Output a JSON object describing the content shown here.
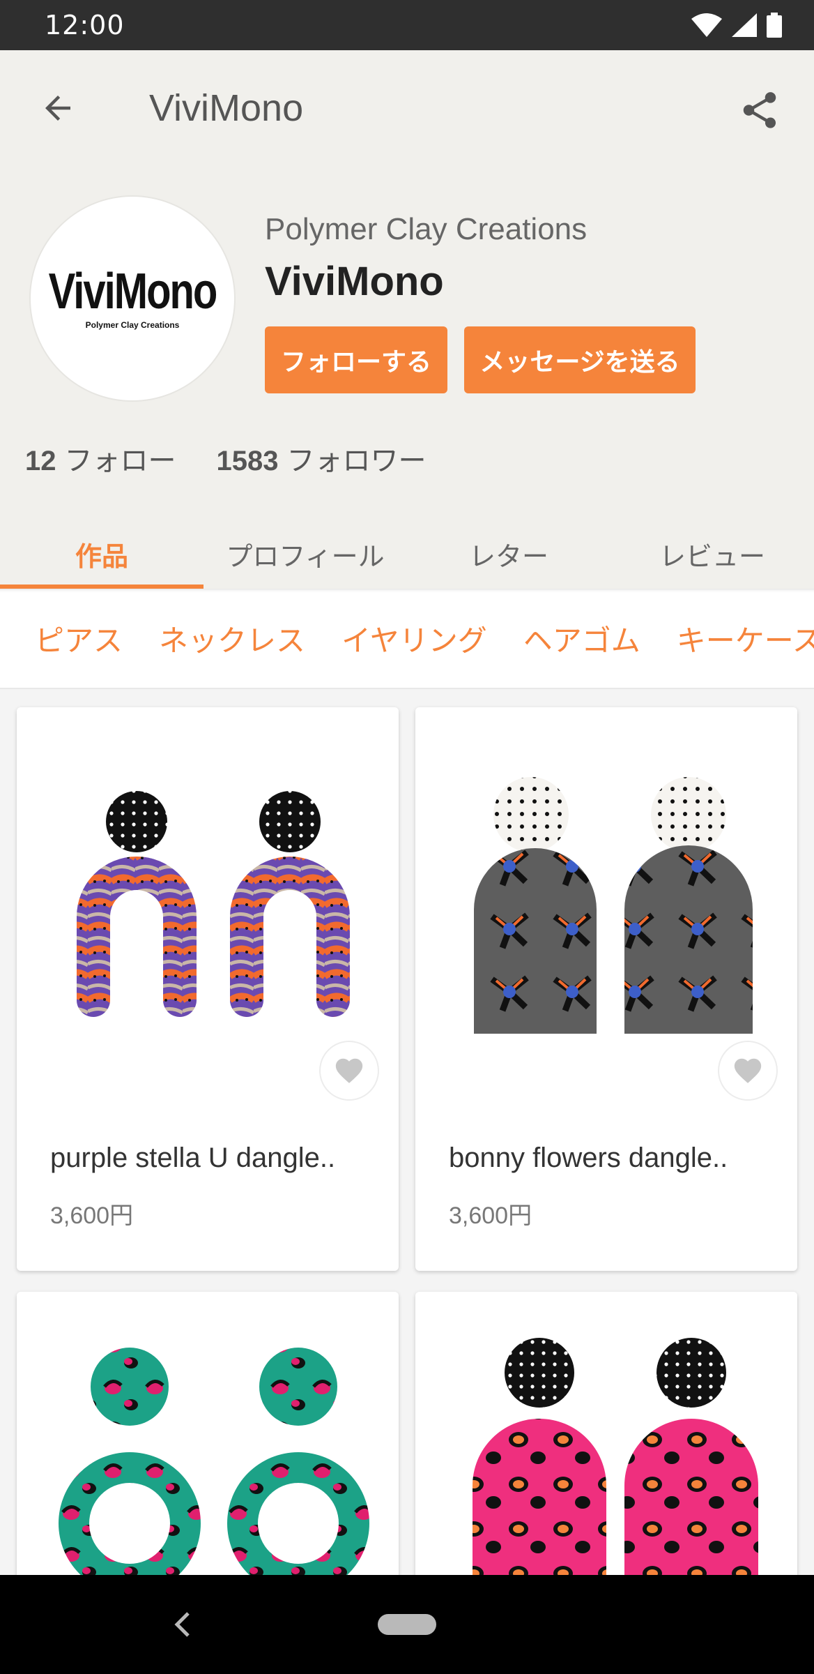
{
  "status_bar": {
    "time": "12:00"
  },
  "app_bar": {
    "title": "ViviMono"
  },
  "profile": {
    "avatar_logo": "ViviMono",
    "avatar_subtitle": "Polymer Clay Creations",
    "subtitle": "Polymer Clay Creations",
    "name": "ViviMono",
    "follow_button": "フォローする",
    "message_button": "メッセージを送る",
    "following_count": "12",
    "following_label": "フォロー",
    "followers_count": "1583",
    "followers_label": "フォロワー"
  },
  "tabs": [
    {
      "label": "作品",
      "active": true
    },
    {
      "label": "プロフィール",
      "active": false
    },
    {
      "label": "レター",
      "active": false
    },
    {
      "label": "レビュー",
      "active": false
    }
  ],
  "categories": [
    "ピアス",
    "ネックレス",
    "イヤリング",
    "ヘアゴム",
    "キーケース"
  ],
  "products": [
    {
      "title": "purple stella U dangle..",
      "price": "3,600円"
    },
    {
      "title": "bonny flowers dangle..",
      "price": "3,600円"
    },
    {
      "title": "",
      "price": ""
    },
    {
      "title": "",
      "price": ""
    }
  ],
  "colors": {
    "accent": "#f5843b",
    "header_bg": "#f1f0ec",
    "status_bar": "#2f2f2f"
  },
  "icons": [
    "back-arrow-icon",
    "share-icon",
    "heart-icon",
    "wifi-icon",
    "signal-icon",
    "battery-icon"
  ]
}
